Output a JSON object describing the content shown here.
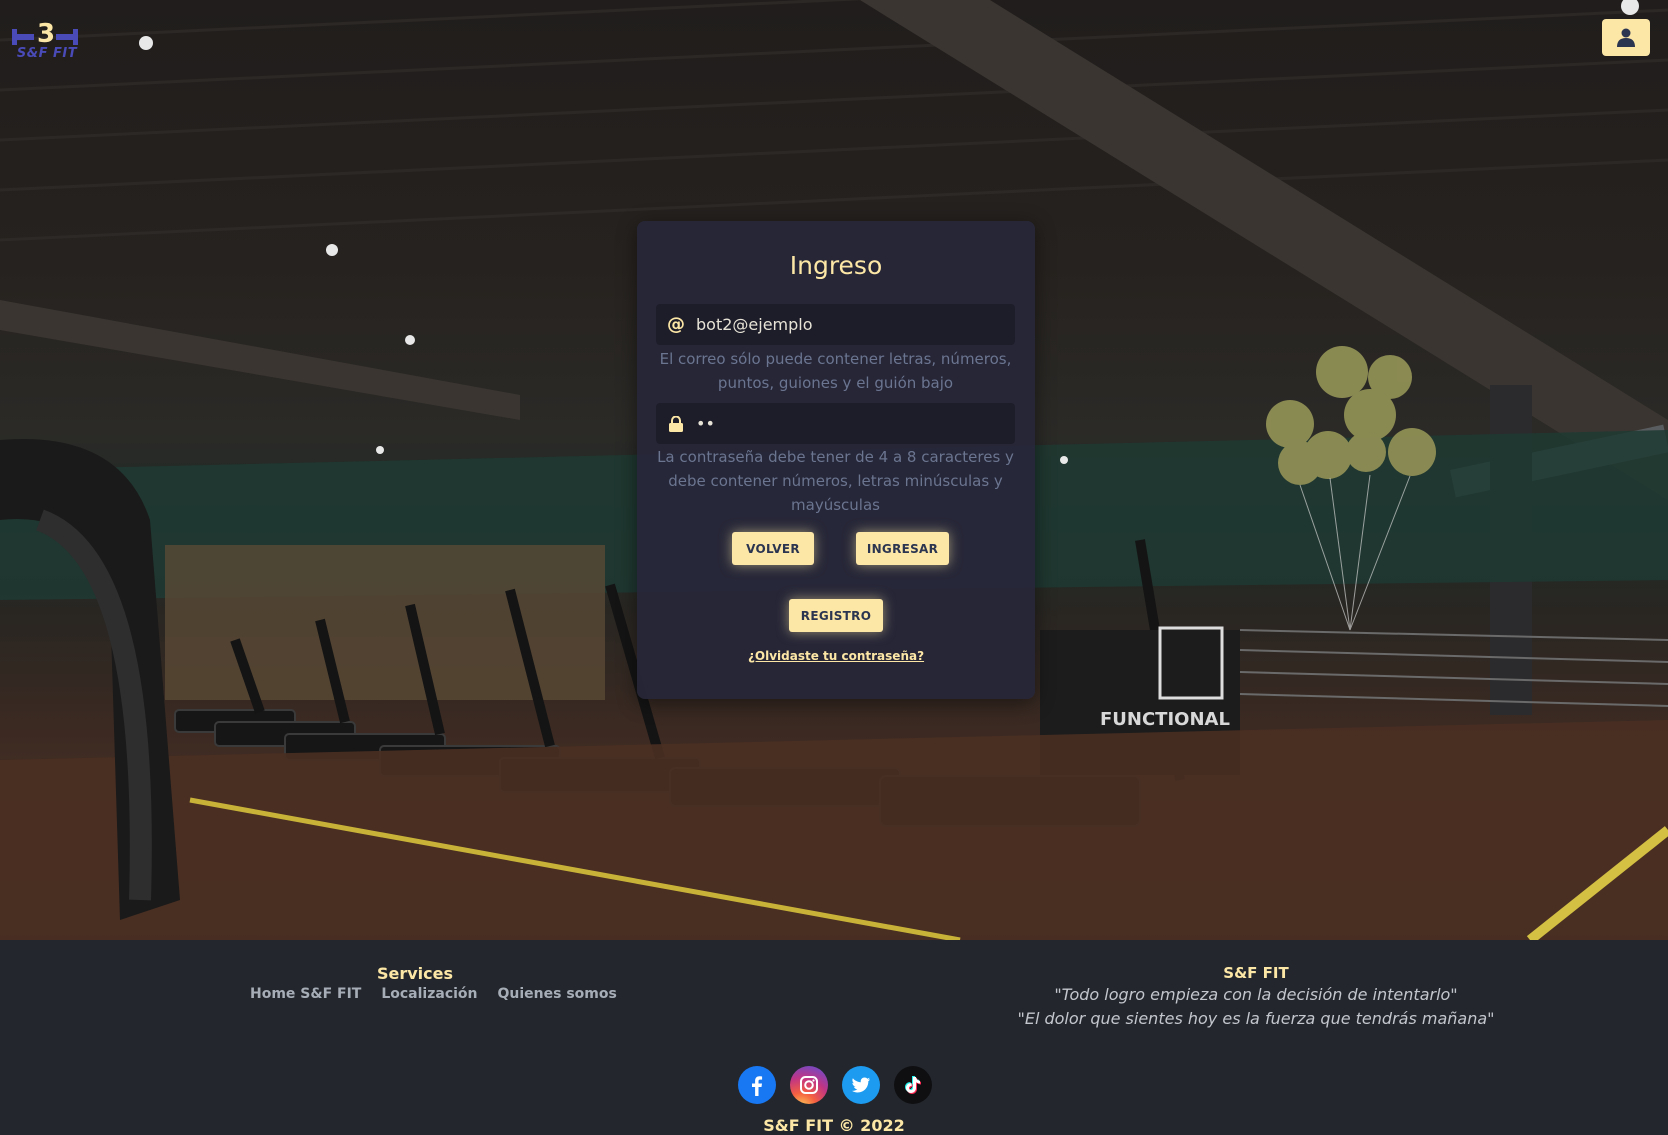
{
  "header": {
    "logo_text": "S&F FIT",
    "user_button_icon": "user-icon"
  },
  "login": {
    "title": "Ingreso",
    "email_icon": "@",
    "email_value": "bot2@ejemplo",
    "email_help": "El correo sólo puede contener letras, números, puntos, guiones y el guión bajo",
    "password_icon": "lock-icon",
    "password_value": "••",
    "password_help": "La contraseña debe tener de 4 a 8 caracteres y debe contener números, letras minúsculas y mayúsculas",
    "back_label": "VOLVER",
    "submit_label": "INGRESAR",
    "register_label": "REGISTRO",
    "forgot_label": "¿Olvidaste tu contraseña?"
  },
  "footer": {
    "services_title": "Services",
    "links": [
      "Home S&F FIT",
      "Localización",
      "Quienes somos"
    ],
    "brand_title": "S&F FIT",
    "quotes": [
      "\"Todo logro empieza con la decisión de intentarlo\"",
      "\"El dolor que sientes hoy es la fuerza que tendrás mañana\""
    ],
    "socials": [
      "facebook-icon",
      "instagram-icon",
      "twitter-icon",
      "tiktok-icon"
    ],
    "copyright": "S&F FIT © 2022"
  },
  "colors": {
    "accent": "#fde7a6",
    "card": "#262638",
    "footer": "#23272d"
  }
}
